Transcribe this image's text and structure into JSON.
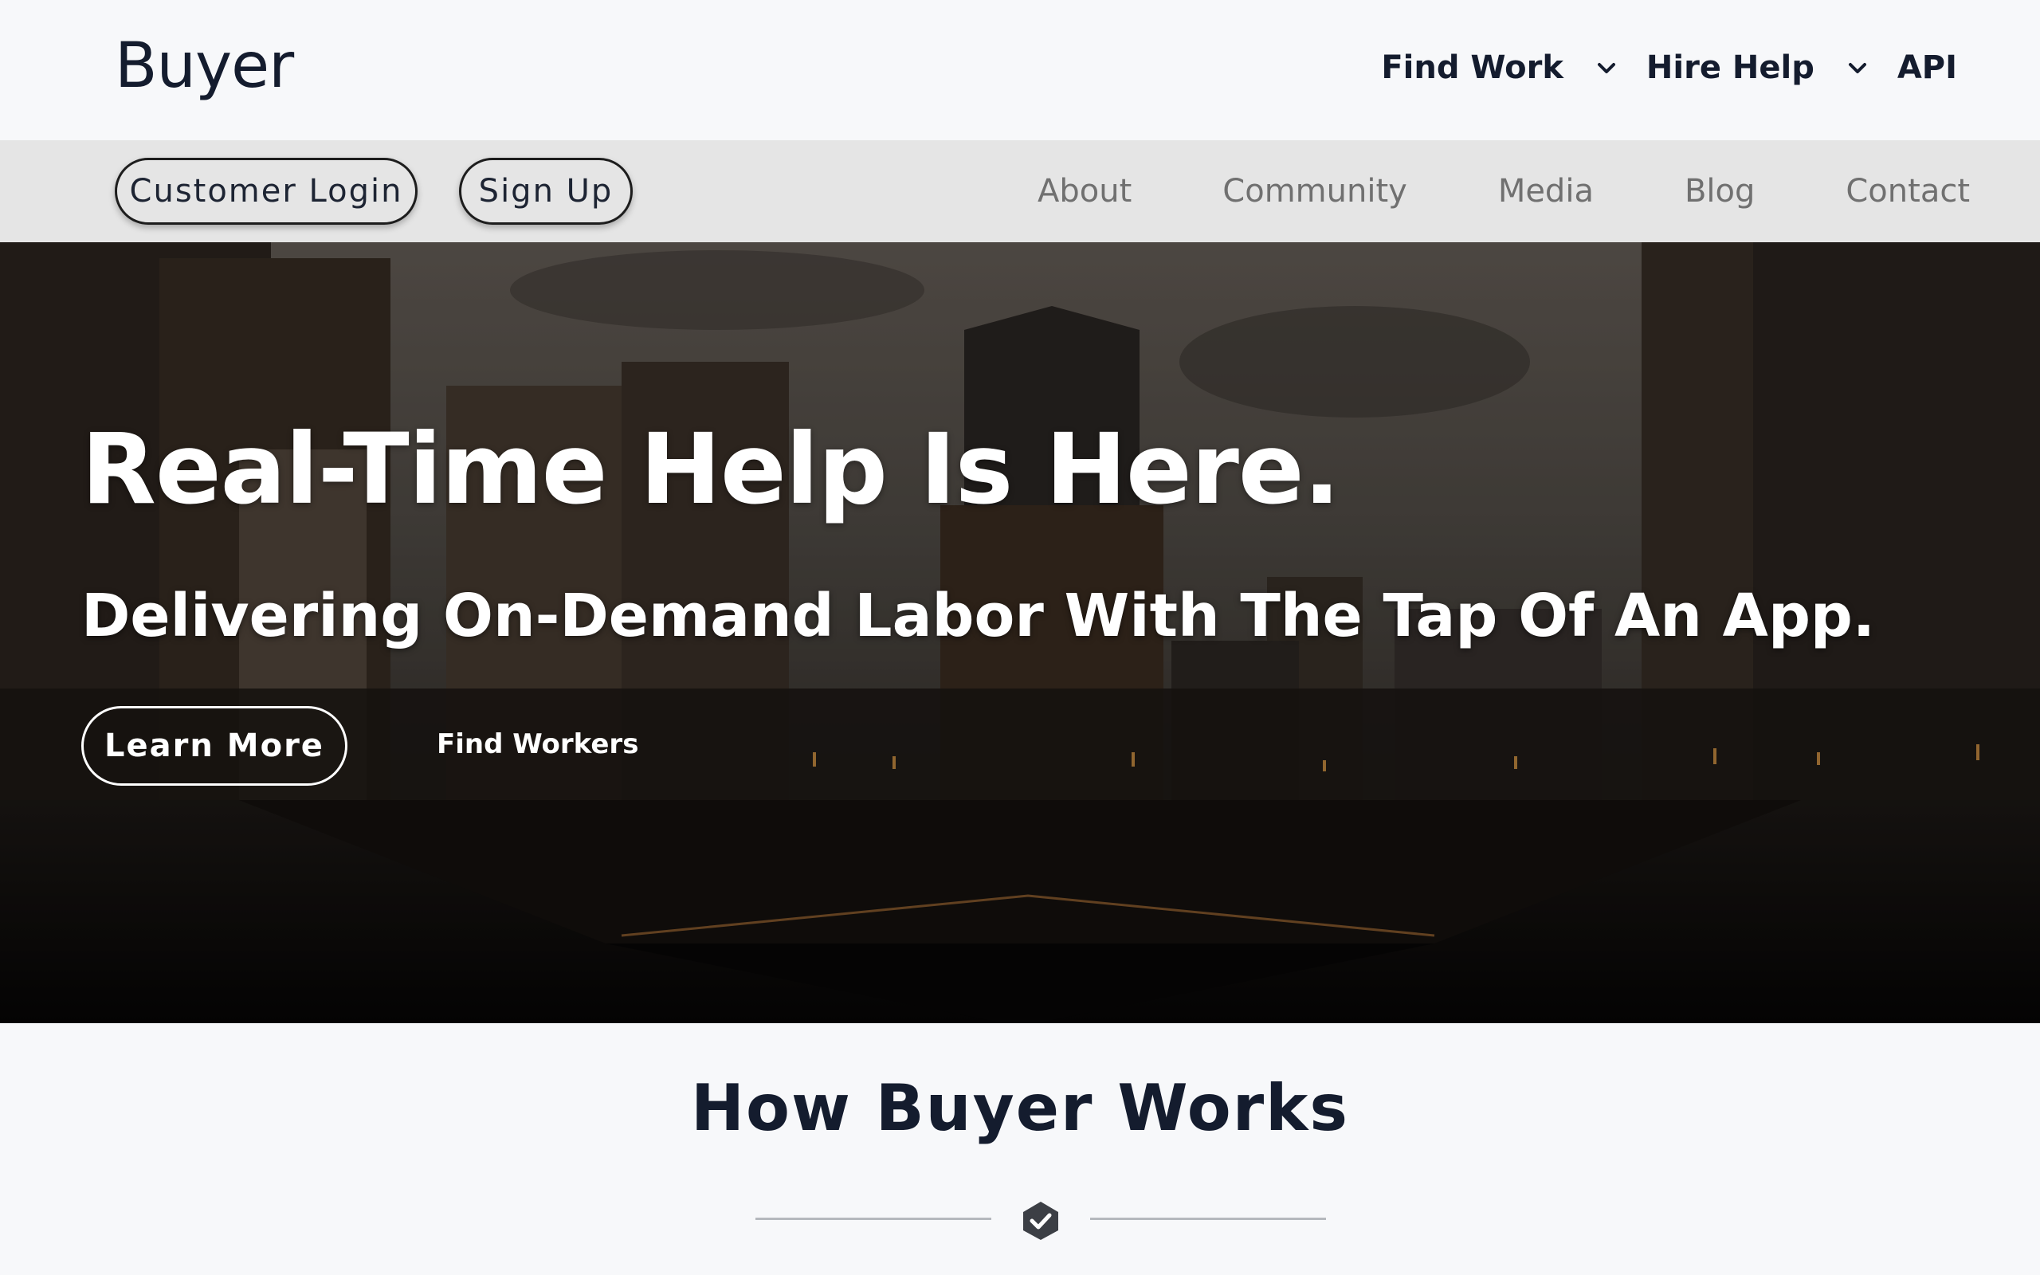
{
  "header": {
    "brand": "Buyer",
    "nav": [
      {
        "label": "Find Work",
        "has_dropdown": true
      },
      {
        "label": "Hire Help",
        "has_dropdown": true
      },
      {
        "label": "API",
        "has_dropdown": false
      }
    ]
  },
  "subbar": {
    "login_label": "Customer Login",
    "signup_label": "Sign Up",
    "links": [
      "About",
      "Community",
      "Media",
      "Blog",
      "Contact"
    ]
  },
  "hero": {
    "title": "Real-Time Help Is Here.",
    "subtitle": "Delivering On-Demand Labor With The Tap Of An App.",
    "primary_button": "Learn More",
    "secondary_button": "Find Workers"
  },
  "how": {
    "title": "How Buyer Works",
    "icon": "check-shield-icon"
  },
  "colors": {
    "text_dark": "#141c2e",
    "subbar_bg": "#e5e5e5",
    "subnav_text": "#707070",
    "page_bg": "#f7f8fa"
  }
}
